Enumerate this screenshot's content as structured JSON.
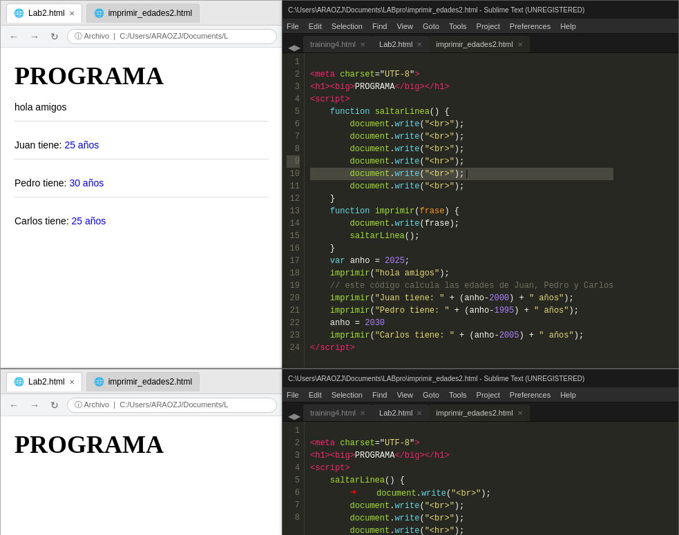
{
  "browser1": {
    "title": "Lab2.html",
    "tab1": "Lab2.html",
    "tab2": "imprimir_edades2.html",
    "address": "Archivo | C:/Users/ARAOZJ/Documents/L",
    "content": {
      "title": "PROGRAMA",
      "lines": [
        {
          "text": "hola amigos",
          "color": "black"
        },
        {
          "text": "",
          "color": "black"
        },
        {
          "label": "Juan tiene: ",
          "value": "25 años",
          "color": "blue"
        },
        {
          "text": "",
          "color": "black"
        },
        {
          "label": "Pedro tiene: ",
          "value": "30 años",
          "color": "blue"
        },
        {
          "text": "",
          "color": "black"
        },
        {
          "label": "Carlos tiene: ",
          "value": "25 años",
          "color": "blue"
        }
      ]
    }
  },
  "sublime1": {
    "title": "C:\\Users\\ARAOZJ\\Documents\\LABpro\\imprimir_edades2.html - Sublime Text (UNREGISTERED)",
    "menu": [
      "File",
      "Edit",
      "Selection",
      "Find",
      "View",
      "Goto",
      "Tools",
      "Project",
      "Preferences",
      "Help"
    ],
    "tabs": [
      "training4.html",
      "Lab2.html",
      "imprimir_edades2.html"
    ],
    "active_tab": "imprimir_edades2.html"
  },
  "sublime2": {
    "title": "C:\\Users\\ARAOZJ\\Documents\\LABpro\\imprimir_edades2.html - Sublime Text (UNREGISTERED)",
    "menu": [
      "File",
      "Edit",
      "Selection",
      "Find",
      "View",
      "Goto",
      "Tools",
      "Project",
      "Preferences",
      "Help"
    ],
    "tabs": [
      "training4.html",
      "Lab2.html",
      "imprimir_edades2.html"
    ],
    "active_tab": "imprimir_edades2.html"
  },
  "browser2": {
    "title": "Lab2.html",
    "tab1": "Lab2.html",
    "tab2": "imprimir_edades2.html",
    "address": "Archivo | C:/Users/ARAOZJ/Documents/L",
    "content": {
      "title": "PROGRAMA"
    }
  },
  "icons": {
    "globe": "🌐",
    "reload": "↻",
    "back": "←",
    "forward": "→",
    "nav_arrows": "◀▶"
  }
}
